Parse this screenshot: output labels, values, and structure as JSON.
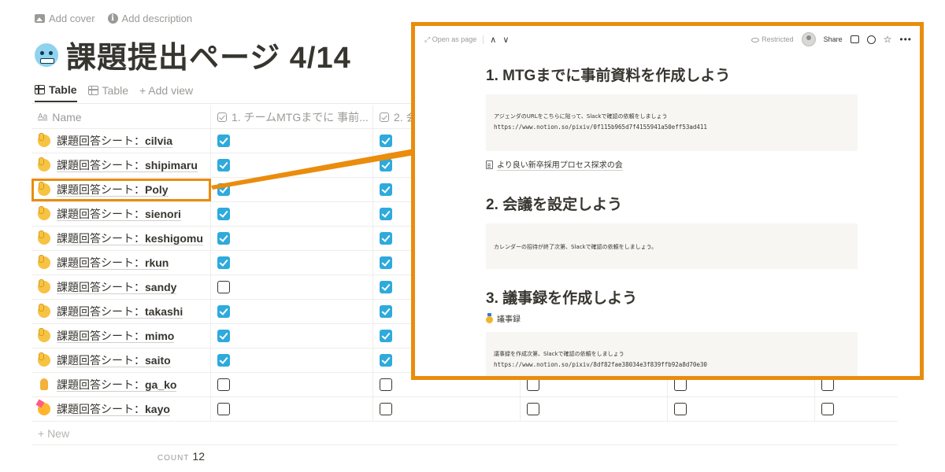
{
  "page": {
    "add_cover": "Add cover",
    "add_description": "Add description",
    "title": "課題提出ページ 4/14",
    "title_emoji": "cold-face-emoji"
  },
  "views": [
    {
      "label": "Table",
      "active": true
    },
    {
      "label": "Table",
      "active": false
    }
  ],
  "add_view": "+ Add view",
  "table": {
    "columns": [
      "Name",
      "1. チームMTGまでに 事前...",
      "2. 会",
      "",
      "",
      ""
    ],
    "rows": [
      {
        "emoji": "person-raising-hand-emoji",
        "prefix": "課題回答シート：",
        "name": "cilvia",
        "checks": [
          true,
          true,
          false,
          false,
          false
        ]
      },
      {
        "emoji": "person-raising-hand-emoji",
        "prefix": "課題回答シート：",
        "name": "shipimaru",
        "checks": [
          true,
          true,
          false,
          false,
          false
        ]
      },
      {
        "emoji": "person-raising-hand-emoji",
        "prefix": "課題回答シート：",
        "name": "Poly",
        "checks": [
          true,
          true,
          false,
          false,
          false
        ]
      },
      {
        "emoji": "person-raising-hand-emoji",
        "prefix": "課題回答シート：",
        "name": "sienori",
        "checks": [
          true,
          true,
          false,
          false,
          false
        ]
      },
      {
        "emoji": "person-raising-hand-emoji",
        "prefix": "課題回答シート：",
        "name": "keshigomu",
        "checks": [
          true,
          true,
          false,
          false,
          false
        ]
      },
      {
        "emoji": "person-raising-hand-emoji",
        "prefix": "課題回答シート：",
        "name": "rkun",
        "checks": [
          true,
          true,
          false,
          false,
          false
        ]
      },
      {
        "emoji": "person-raising-hand-emoji",
        "prefix": "課題回答シート：",
        "name": "sandy",
        "checks": [
          false,
          true,
          false,
          false,
          false
        ]
      },
      {
        "emoji": "person-raising-hand-emoji",
        "prefix": "課題回答シート：",
        "name": "takashi",
        "checks": [
          true,
          true,
          false,
          false,
          false
        ]
      },
      {
        "emoji": "person-raising-hand-emoji",
        "prefix": "課題回答シート：",
        "name": "mimo",
        "checks": [
          true,
          true,
          false,
          false,
          false
        ]
      },
      {
        "emoji": "person-raising-hand-emoji",
        "prefix": "課題回答シート：",
        "name": "saito",
        "checks": [
          true,
          true,
          false,
          false,
          false
        ]
      },
      {
        "emoji": "folded-hands-emoji",
        "prefix": "課題回答シート：",
        "name": "ga_ko",
        "checks": [
          false,
          false,
          false,
          false,
          false
        ]
      },
      {
        "emoji": "partying-face-emoji",
        "prefix": "課題回答シート：",
        "name": "kayo",
        "checks": [
          false,
          false,
          false,
          false,
          false
        ]
      }
    ],
    "new_label": "+ New",
    "count_label": "COUNT",
    "count_value": "12"
  },
  "preview": {
    "open_as_page": "Open as page",
    "restricted": "Restricted",
    "share": "Share",
    "sections": [
      {
        "heading": "1. MTGまでに事前資料を作成しよう",
        "lines": [
          "アジェンダのURLをこちらに貼って、Slackで確認の依頼をしましょう",
          "https://www.notion.so/pixiv/0f115b965d7f4155941a50eff53ad411"
        ],
        "link": "より良い新卒採用プロセス探求の会"
      },
      {
        "heading": "2. 会議を設定しよう",
        "lines": [
          "カレンダーの招待が終了次第、Slackで確認の依頼をしましょう。"
        ]
      },
      {
        "heading": "3. 議事録を作成しよう",
        "link": "議事録",
        "lines": [
          "議事録を作成次第、Slackで確認の依頼をしましょう",
          "https://www.notion.so/pixiv/8df82fae38034e3f839ffb92a8d70e30"
        ]
      }
    ]
  },
  "colors": {
    "accent_orange": "#ea8c0c",
    "checkbox_blue": "#2eaadc"
  }
}
